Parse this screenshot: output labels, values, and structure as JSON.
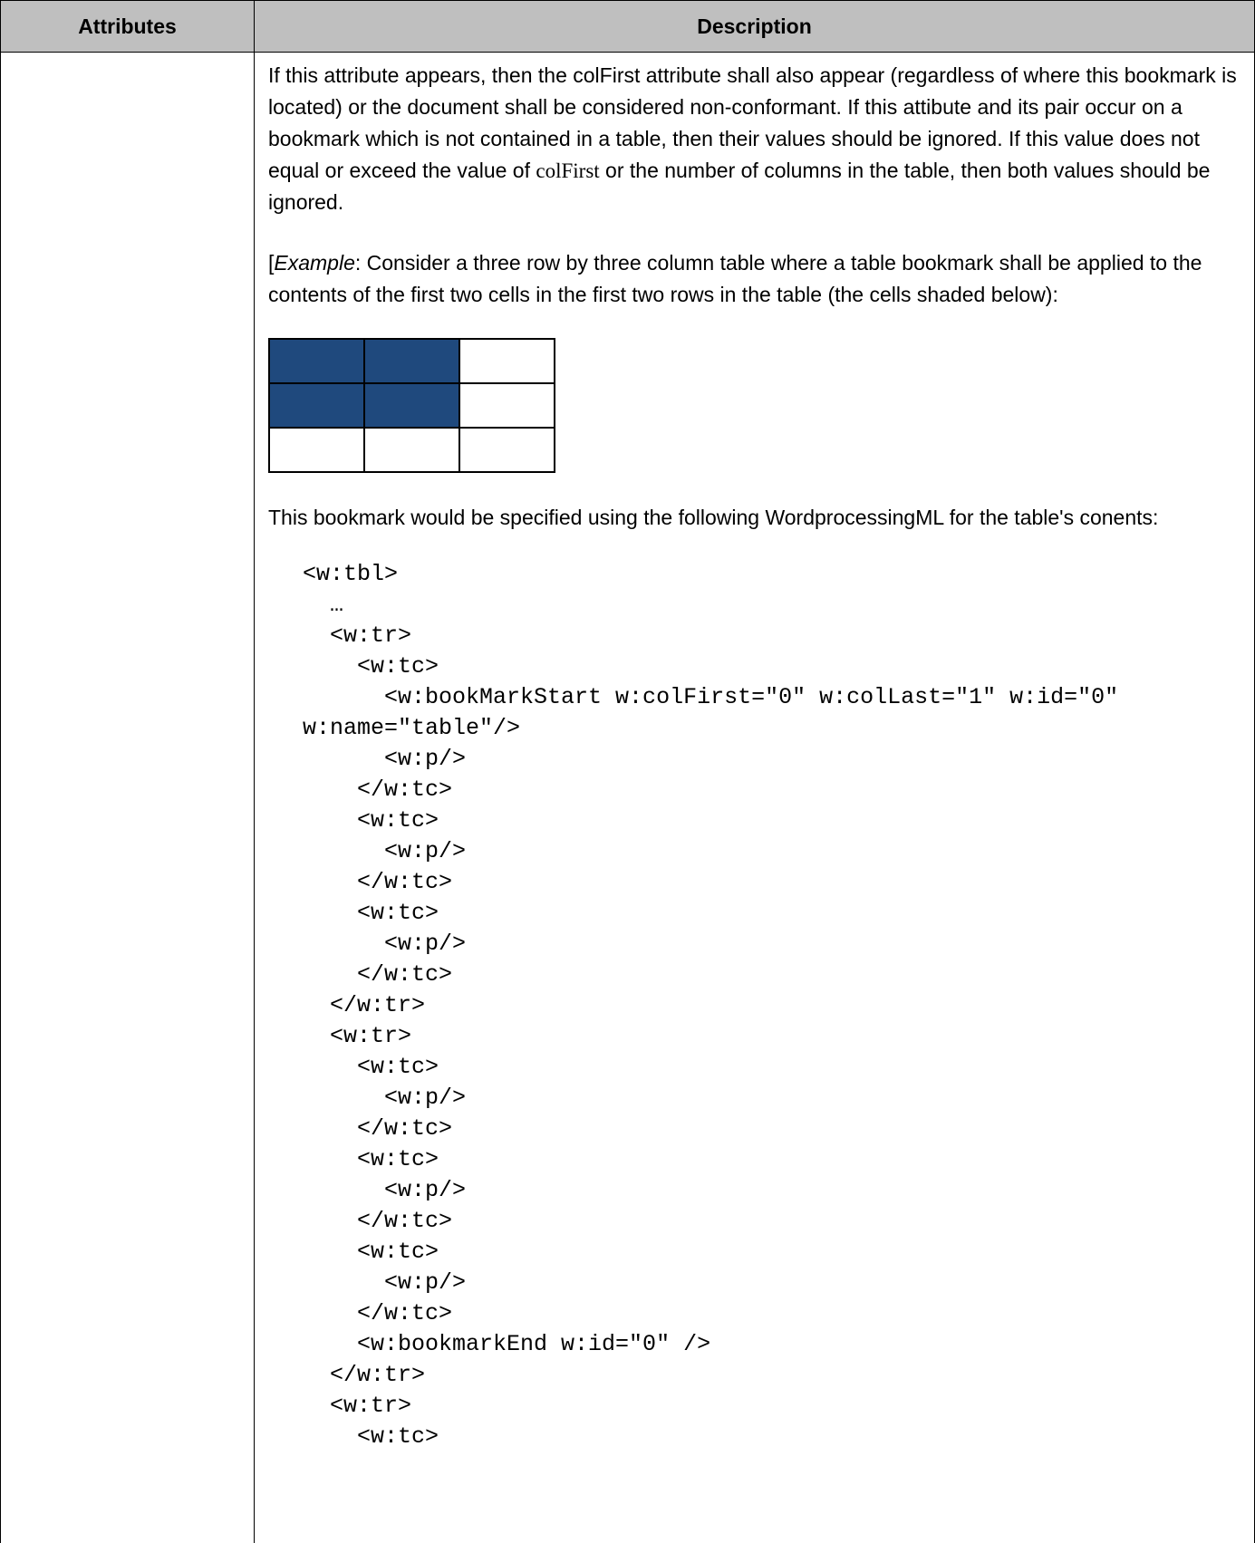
{
  "table": {
    "headers": [
      "Attributes",
      "Description"
    ],
    "attribute_cell": ""
  },
  "description": {
    "para1_part1": "If this attribute appears, then the colFirst attribute shall also appear (regardless of where this bookmark is located) or the document shall be considered non-conformant. If this attibute and its pair occur on a bookmark which is not contained in a table, then their values should be ignored. If this value does not equal or exceed the value of ",
    "para1_code": "colFirst",
    "para1_part2": " or the number of columns in the table, then both values should be ignored.",
    "example_open": "[",
    "example_word": "Example",
    "example_text": ": Consider a three row by three column table where a table bookmark shall be applied to the contents of the first two cells in the first two rows in the table (the cells shaded below):",
    "para3": "This bookmark would be specified using the following WordprocessingML for the table's conents:"
  },
  "colors": {
    "shaded": "#1f497d",
    "unshaded": "#ffffff",
    "header_bg": "#bfbfbf"
  },
  "mini_grid": {
    "rows": 3,
    "cols": 3,
    "shaded": [
      [
        true,
        true,
        false
      ],
      [
        true,
        true,
        false
      ],
      [
        false,
        false,
        false
      ]
    ]
  },
  "code_lines": [
    "<w:tbl>",
    "  …",
    "  <w:tr>",
    "    <w:tc>",
    "      <w:bookMarkStart w:colFirst=\"0\" w:colLast=\"1\" w:id=\"0\"",
    "w:name=\"table\"/>",
    "      <w:p/>",
    "    </w:tc>",
    "    <w:tc>",
    "      <w:p/>",
    "    </w:tc>",
    "    <w:tc>",
    "      <w:p/>",
    "    </w:tc>",
    "  </w:tr>",
    "  <w:tr>",
    "    <w:tc>",
    "      <w:p/>",
    "    </w:tc>",
    "    <w:tc>",
    "      <w:p/>",
    "    </w:tc>",
    "    <w:tc>",
    "      <w:p/>",
    "    </w:tc>",
    "    <w:bookmarkEnd w:id=\"0\" />",
    "  </w:tr>",
    "  <w:tr>",
    "    <w:tc>"
  ]
}
